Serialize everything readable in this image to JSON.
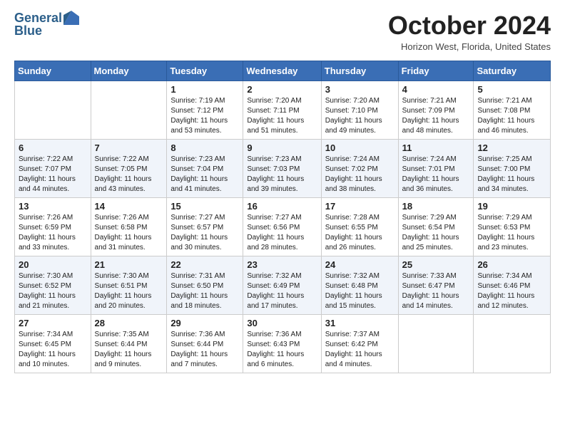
{
  "header": {
    "logo_line1": "General",
    "logo_line2": "Blue",
    "month": "October 2024",
    "location": "Horizon West, Florida, United States"
  },
  "days_of_week": [
    "Sunday",
    "Monday",
    "Tuesday",
    "Wednesday",
    "Thursday",
    "Friday",
    "Saturday"
  ],
  "weeks": [
    [
      {
        "day": "",
        "sunrise": "",
        "sunset": "",
        "daylight": ""
      },
      {
        "day": "",
        "sunrise": "",
        "sunset": "",
        "daylight": ""
      },
      {
        "day": "1",
        "sunrise": "Sunrise: 7:19 AM",
        "sunset": "Sunset: 7:12 PM",
        "daylight": "Daylight: 11 hours and 53 minutes."
      },
      {
        "day": "2",
        "sunrise": "Sunrise: 7:20 AM",
        "sunset": "Sunset: 7:11 PM",
        "daylight": "Daylight: 11 hours and 51 minutes."
      },
      {
        "day": "3",
        "sunrise": "Sunrise: 7:20 AM",
        "sunset": "Sunset: 7:10 PM",
        "daylight": "Daylight: 11 hours and 49 minutes."
      },
      {
        "day": "4",
        "sunrise": "Sunrise: 7:21 AM",
        "sunset": "Sunset: 7:09 PM",
        "daylight": "Daylight: 11 hours and 48 minutes."
      },
      {
        "day": "5",
        "sunrise": "Sunrise: 7:21 AM",
        "sunset": "Sunset: 7:08 PM",
        "daylight": "Daylight: 11 hours and 46 minutes."
      }
    ],
    [
      {
        "day": "6",
        "sunrise": "Sunrise: 7:22 AM",
        "sunset": "Sunset: 7:07 PM",
        "daylight": "Daylight: 11 hours and 44 minutes."
      },
      {
        "day": "7",
        "sunrise": "Sunrise: 7:22 AM",
        "sunset": "Sunset: 7:05 PM",
        "daylight": "Daylight: 11 hours and 43 minutes."
      },
      {
        "day": "8",
        "sunrise": "Sunrise: 7:23 AM",
        "sunset": "Sunset: 7:04 PM",
        "daylight": "Daylight: 11 hours and 41 minutes."
      },
      {
        "day": "9",
        "sunrise": "Sunrise: 7:23 AM",
        "sunset": "Sunset: 7:03 PM",
        "daylight": "Daylight: 11 hours and 39 minutes."
      },
      {
        "day": "10",
        "sunrise": "Sunrise: 7:24 AM",
        "sunset": "Sunset: 7:02 PM",
        "daylight": "Daylight: 11 hours and 38 minutes."
      },
      {
        "day": "11",
        "sunrise": "Sunrise: 7:24 AM",
        "sunset": "Sunset: 7:01 PM",
        "daylight": "Daylight: 11 hours and 36 minutes."
      },
      {
        "day": "12",
        "sunrise": "Sunrise: 7:25 AM",
        "sunset": "Sunset: 7:00 PM",
        "daylight": "Daylight: 11 hours and 34 minutes."
      }
    ],
    [
      {
        "day": "13",
        "sunrise": "Sunrise: 7:26 AM",
        "sunset": "Sunset: 6:59 PM",
        "daylight": "Daylight: 11 hours and 33 minutes."
      },
      {
        "day": "14",
        "sunrise": "Sunrise: 7:26 AM",
        "sunset": "Sunset: 6:58 PM",
        "daylight": "Daylight: 11 hours and 31 minutes."
      },
      {
        "day": "15",
        "sunrise": "Sunrise: 7:27 AM",
        "sunset": "Sunset: 6:57 PM",
        "daylight": "Daylight: 11 hours and 30 minutes."
      },
      {
        "day": "16",
        "sunrise": "Sunrise: 7:27 AM",
        "sunset": "Sunset: 6:56 PM",
        "daylight": "Daylight: 11 hours and 28 minutes."
      },
      {
        "day": "17",
        "sunrise": "Sunrise: 7:28 AM",
        "sunset": "Sunset: 6:55 PM",
        "daylight": "Daylight: 11 hours and 26 minutes."
      },
      {
        "day": "18",
        "sunrise": "Sunrise: 7:29 AM",
        "sunset": "Sunset: 6:54 PM",
        "daylight": "Daylight: 11 hours and 25 minutes."
      },
      {
        "day": "19",
        "sunrise": "Sunrise: 7:29 AM",
        "sunset": "Sunset: 6:53 PM",
        "daylight": "Daylight: 11 hours and 23 minutes."
      }
    ],
    [
      {
        "day": "20",
        "sunrise": "Sunrise: 7:30 AM",
        "sunset": "Sunset: 6:52 PM",
        "daylight": "Daylight: 11 hours and 21 minutes."
      },
      {
        "day": "21",
        "sunrise": "Sunrise: 7:30 AM",
        "sunset": "Sunset: 6:51 PM",
        "daylight": "Daylight: 11 hours and 20 minutes."
      },
      {
        "day": "22",
        "sunrise": "Sunrise: 7:31 AM",
        "sunset": "Sunset: 6:50 PM",
        "daylight": "Daylight: 11 hours and 18 minutes."
      },
      {
        "day": "23",
        "sunrise": "Sunrise: 7:32 AM",
        "sunset": "Sunset: 6:49 PM",
        "daylight": "Daylight: 11 hours and 17 minutes."
      },
      {
        "day": "24",
        "sunrise": "Sunrise: 7:32 AM",
        "sunset": "Sunset: 6:48 PM",
        "daylight": "Daylight: 11 hours and 15 minutes."
      },
      {
        "day": "25",
        "sunrise": "Sunrise: 7:33 AM",
        "sunset": "Sunset: 6:47 PM",
        "daylight": "Daylight: 11 hours and 14 minutes."
      },
      {
        "day": "26",
        "sunrise": "Sunrise: 7:34 AM",
        "sunset": "Sunset: 6:46 PM",
        "daylight": "Daylight: 11 hours and 12 minutes."
      }
    ],
    [
      {
        "day": "27",
        "sunrise": "Sunrise: 7:34 AM",
        "sunset": "Sunset: 6:45 PM",
        "daylight": "Daylight: 11 hours and 10 minutes."
      },
      {
        "day": "28",
        "sunrise": "Sunrise: 7:35 AM",
        "sunset": "Sunset: 6:44 PM",
        "daylight": "Daylight: 11 hours and 9 minutes."
      },
      {
        "day": "29",
        "sunrise": "Sunrise: 7:36 AM",
        "sunset": "Sunset: 6:44 PM",
        "daylight": "Daylight: 11 hours and 7 minutes."
      },
      {
        "day": "30",
        "sunrise": "Sunrise: 7:36 AM",
        "sunset": "Sunset: 6:43 PM",
        "daylight": "Daylight: 11 hours and 6 minutes."
      },
      {
        "day": "31",
        "sunrise": "Sunrise: 7:37 AM",
        "sunset": "Sunset: 6:42 PM",
        "daylight": "Daylight: 11 hours and 4 minutes."
      },
      {
        "day": "",
        "sunrise": "",
        "sunset": "",
        "daylight": ""
      },
      {
        "day": "",
        "sunrise": "",
        "sunset": "",
        "daylight": ""
      }
    ]
  ]
}
